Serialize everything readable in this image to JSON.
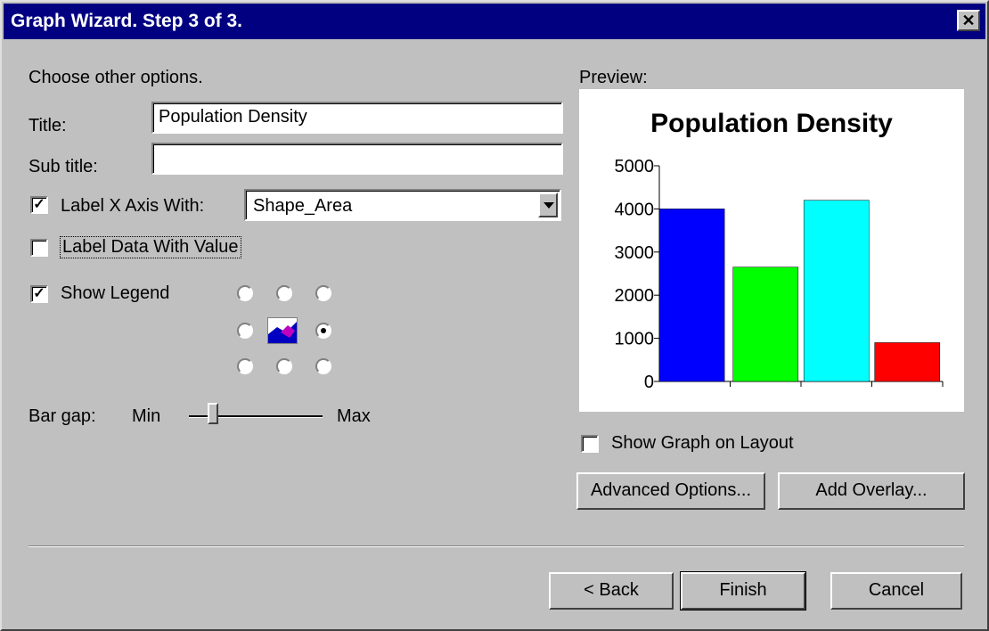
{
  "window": {
    "title": "Graph Wizard. Step 3 of 3.",
    "close_glyph": "✕"
  },
  "main": {
    "instructions": "Choose other options.",
    "title_label": "Title:",
    "title_value": "Population Density",
    "subtitle_label": "Sub title:",
    "subtitle_value": "",
    "label_x_axis": {
      "label": "Label X Axis With:",
      "checked": true,
      "value": "Shape_Area"
    },
    "label_data_with_value": {
      "label": "Label Data With Value",
      "checked": false
    },
    "show_legend": {
      "label": "Show Legend",
      "checked": true,
      "selected_position": "middle-right"
    },
    "bar_gap": {
      "label": "Bar gap:",
      "min_label": "Min",
      "max_label": "Max",
      "value": 0.15
    }
  },
  "preview": {
    "label": "Preview:",
    "show_on_layout": {
      "label": "Show Graph on Layout",
      "checked": false
    }
  },
  "buttons": {
    "advanced": "Advanced Options...",
    "add_overlay": "Add Overlay...",
    "back": "< Back",
    "finish": "Finish",
    "cancel": "Cancel"
  },
  "chart_data": {
    "type": "bar",
    "title": "Population Density",
    "categories": [
      "",
      "",
      "",
      ""
    ],
    "values": [
      4000,
      2650,
      4200,
      900
    ],
    "colors": [
      "#0000ff",
      "#00ff00",
      "#00ffff",
      "#ff0000"
    ],
    "ylim": [
      0,
      5000
    ],
    "yticks": [
      "0",
      "1000",
      "2000",
      "3000",
      "4000",
      "5000"
    ]
  }
}
